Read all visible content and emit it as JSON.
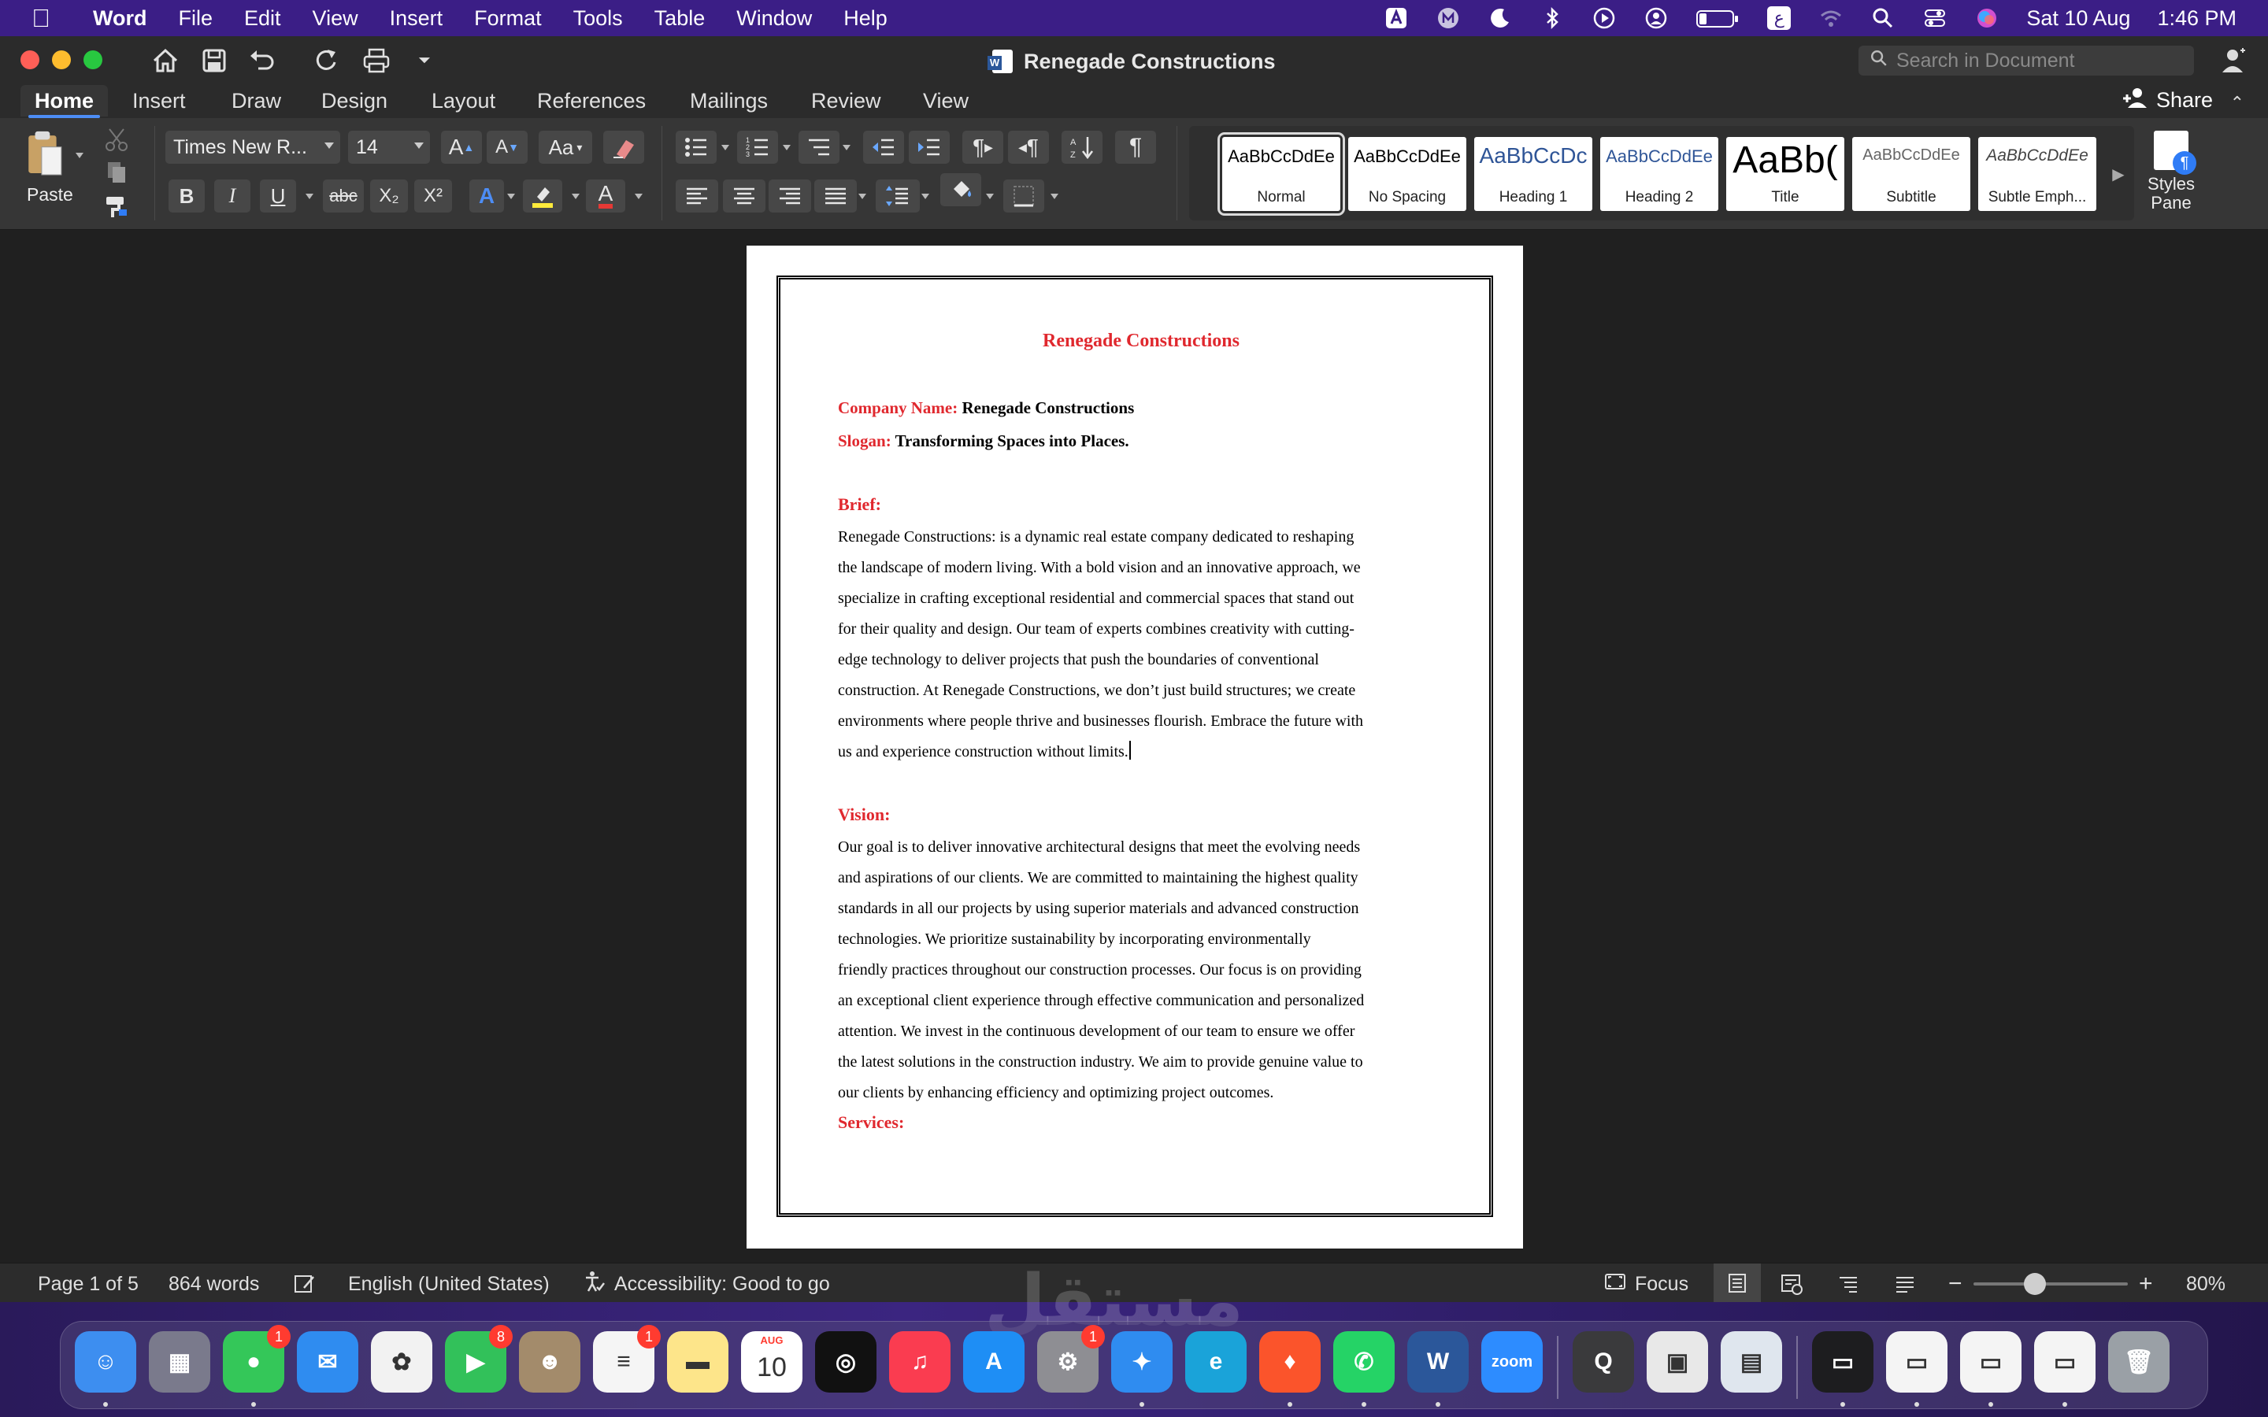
{
  "menubar": {
    "app": "Word",
    "items": [
      "File",
      "Edit",
      "View",
      "Insert",
      "Format",
      "Tools",
      "Table",
      "Window",
      "Help"
    ],
    "status_icons": [
      "a-icon",
      "m-icon",
      "moon-icon",
      "bluetooth-icon",
      "play-circle-icon",
      "user-circle-icon",
      "battery-icon",
      "arabic-input-icon",
      "wifi-icon",
      "search-icon",
      "control-center-icon",
      "siri-icon"
    ],
    "input_source": "ع",
    "date": "Sat 10 Aug",
    "time": "1:46 PM"
  },
  "window": {
    "title": "Renegade Constructions",
    "search_placeholder": "Search in Document"
  },
  "ribbon": {
    "tabs": [
      "Home",
      "Insert",
      "Draw",
      "Design",
      "Layout",
      "References",
      "Mailings",
      "Review",
      "View"
    ],
    "active_tab": "Home",
    "share_label": "Share",
    "paste_label": "Paste",
    "font_name": "Times New R...",
    "font_size": "14",
    "bold": "B",
    "italic": "I",
    "underline": "U",
    "strikethrough": "abc",
    "subscript": "X₂",
    "superscript": "X²",
    "styles": [
      {
        "sample": "AaBbCcDdEe",
        "label": "Normal"
      },
      {
        "sample": "AaBbCcDdEe",
        "label": "No Spacing"
      },
      {
        "sample": "AaBbCcDc",
        "label": "Heading 1"
      },
      {
        "sample": "AaBbCcDdEe",
        "label": "Heading 2"
      },
      {
        "sample": "AaBb(",
        "label": "Title"
      },
      {
        "sample": "AaBbCcDdEe",
        "label": "Subtitle"
      },
      {
        "sample": "AaBbCcDdEe",
        "label": "Subtle Emph..."
      }
    ],
    "styles_pane_label": "Styles Pane",
    "colors": {
      "highlight": "#ffeb3b",
      "font_color": "#e53935",
      "accent": "#4d8df5"
    }
  },
  "document": {
    "title": "Renegade Constructions",
    "company_label": "Company Name:",
    "company_value": "Renegade Constructions",
    "slogan_label": "Slogan:",
    "slogan_value": "Transforming Spaces into Places.",
    "brief_heading": "Brief:",
    "brief_lines": [
      "Renegade Constructions: is a dynamic real estate company dedicated to reshaping",
      "the landscape of modern living. With a bold vision and an innovative approach, we",
      "specialize in crafting exceptional residential and commercial spaces that stand out",
      "for their quality and design. Our team of experts combines creativity with cutting-",
      "edge technology to deliver projects that push the boundaries of conventional",
      "construction. At Renegade Constructions, we don’t just build structures; we create",
      "environments where people thrive and businesses flourish. Embrace the future with",
      "us and experience construction without limits."
    ],
    "vision_heading": "Vision:",
    "vision_lines": [
      "Our goal is to deliver innovative architectural designs that meet the evolving needs",
      "and aspirations of our clients. We are committed to maintaining the highest quality",
      "standards in all our projects by using superior materials and advanced construction",
      "technologies. We prioritize sustainability by incorporating environmentally",
      "friendly practices throughout our construction processes. Our focus is on providing",
      "an exceptional client experience through effective communication and personalized",
      "attention. We invest in the continuous development of our team to ensure we offer",
      "the latest solutions in the construction industry. We aim to provide genuine value to",
      "our clients by enhancing efficiency and optimizing project outcomes."
    ],
    "services_heading": "Services:"
  },
  "statusbar": {
    "page": "Page 1 of 5",
    "words": "864 words",
    "language": "English (United States)",
    "accessibility": "Accessibility: Good to go",
    "focus": "Focus",
    "zoom": "80%",
    "zoom_minus": "−",
    "zoom_plus": "+"
  },
  "dock": {
    "apps": [
      {
        "name": "finder",
        "color": "#3d8ef0",
        "glyph": "☺"
      },
      {
        "name": "launchpad",
        "color": "#7a7a8c",
        "glyph": "▦"
      },
      {
        "name": "messages",
        "color": "#34c759",
        "glyph": "●",
        "badge": "1"
      },
      {
        "name": "mail",
        "color": "#2f8cf0",
        "glyph": "✉"
      },
      {
        "name": "photos",
        "color": "#f2f2f2",
        "glyph": "✿"
      },
      {
        "name": "facetime",
        "color": "#32c15a",
        "glyph": "▶",
        "badge": "8"
      },
      {
        "name": "contacts",
        "color": "#a38b6b",
        "glyph": "☻"
      },
      {
        "name": "reminders",
        "color": "#f5f5f5",
        "glyph": "≡",
        "badge": "1"
      },
      {
        "name": "notes",
        "color": "#fde58a",
        "glyph": "▬"
      },
      {
        "name": "calendar",
        "color": "#ffffff",
        "glyph": "10",
        "caption": "AUG"
      },
      {
        "name": "fitness",
        "color": "#111111",
        "glyph": "◎"
      },
      {
        "name": "music",
        "color": "#fa3c50",
        "glyph": "♫"
      },
      {
        "name": "app-store",
        "color": "#1e8ef5",
        "glyph": "A"
      },
      {
        "name": "system-settings",
        "color": "#8e8e93",
        "glyph": "⚙",
        "badge": "1"
      },
      {
        "name": "safari",
        "color": "#2f8cf0",
        "glyph": "✦"
      },
      {
        "name": "edge",
        "color": "#1aa3d9",
        "glyph": "e"
      },
      {
        "name": "brave",
        "color": "#fb542b",
        "glyph": "♦"
      },
      {
        "name": "whatsapp",
        "color": "#25d366",
        "glyph": "✆"
      },
      {
        "name": "word",
        "color": "#2b579a",
        "glyph": "W"
      },
      {
        "name": "zoom",
        "color": "#2d8cff",
        "glyph": "zoom"
      },
      {
        "name": "quicktime",
        "color": "#3a3a3c",
        "glyph": "Q"
      },
      {
        "name": "preview-app",
        "color": "#e8e8e8",
        "glyph": "▣"
      },
      {
        "name": "image-capture",
        "color": "#dfe6ee",
        "glyph": "▤"
      },
      {
        "name": "window-1",
        "color": "#1d1d1f",
        "glyph": "▭"
      },
      {
        "name": "window-2",
        "color": "#f4f4f4",
        "glyph": "▭"
      },
      {
        "name": "window-3",
        "color": "#f4f4f4",
        "glyph": "▭"
      },
      {
        "name": "window-4",
        "color": "#f4f4f4",
        "glyph": "▭"
      },
      {
        "name": "trash",
        "color": "#9aa0a6",
        "glyph": "🗑"
      }
    ]
  },
  "watermark": "مستقل"
}
